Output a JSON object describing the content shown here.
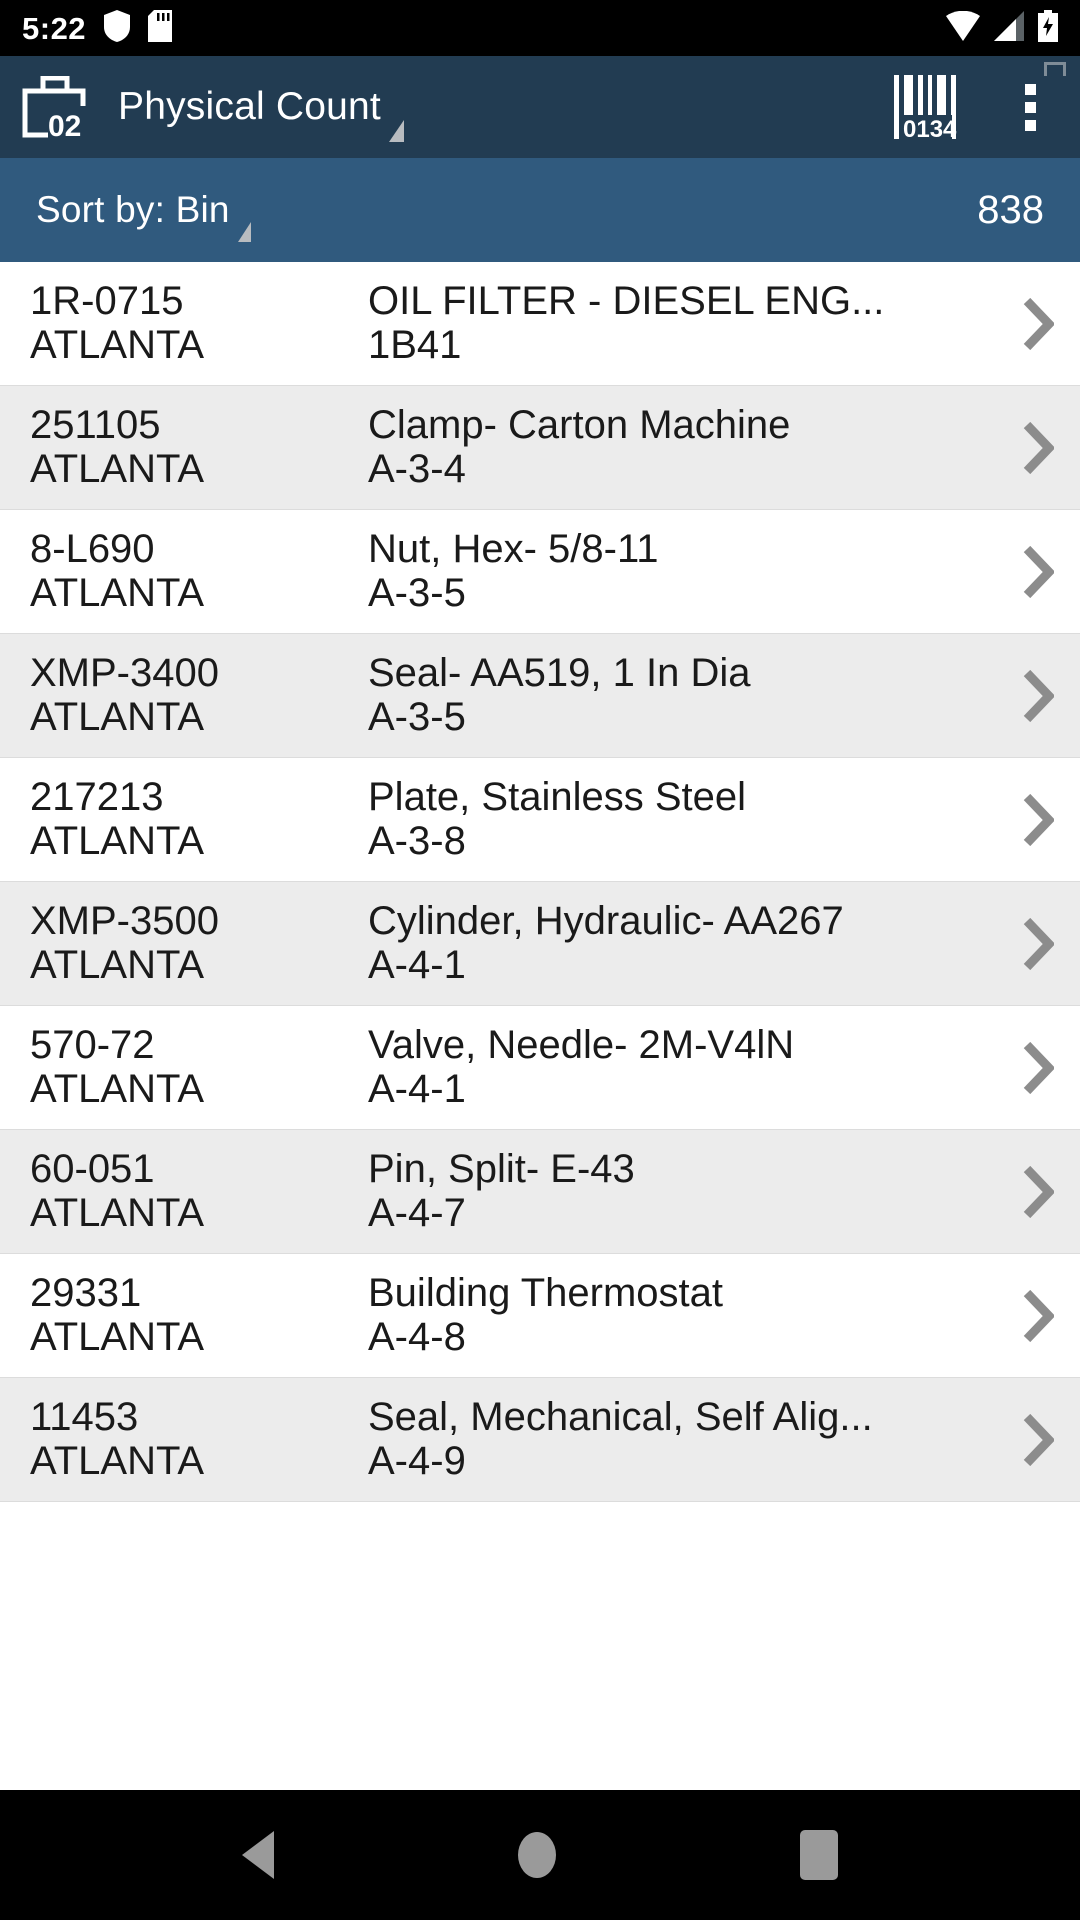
{
  "status_bar": {
    "time": "5:22",
    "left_icons": [
      "shield-icon",
      "sd-card-icon"
    ],
    "right_icons": [
      "wifi-icon",
      "cellular-signal-icon",
      "battery-charging-icon"
    ]
  },
  "app_bar": {
    "logo": "toolbox-count-icon",
    "title": "Physical Count",
    "title_dropdown": "dropdown-caret",
    "barcode_label": "0134",
    "overflow": "overflow-menu-icon"
  },
  "sort_bar": {
    "label": "Sort by: Bin",
    "count": "838"
  },
  "list": {
    "rows": [
      {
        "item": "1R-0715",
        "location": "ATLANTA",
        "description": "OIL FILTER - DIESEL ENG...",
        "bin": "1B41"
      },
      {
        "item": "251105",
        "location": "ATLANTA",
        "description": "Clamp- Carton Machine",
        "bin": "A-3-4"
      },
      {
        "item": "8-L690",
        "location": "ATLANTA",
        "description": "Nut, Hex- 5/8-11",
        "bin": "A-3-5"
      },
      {
        "item": "XMP-3400",
        "location": "ATLANTA",
        "description": "Seal- AA519, 1 In Dia",
        "bin": "A-3-5"
      },
      {
        "item": "217213",
        "location": "ATLANTA",
        "description": "Plate, Stainless Steel",
        "bin": "A-3-8"
      },
      {
        "item": "XMP-3500",
        "location": "ATLANTA",
        "description": "Cylinder, Hydraulic- AA267",
        "bin": "A-4-1"
      },
      {
        "item": "570-72",
        "location": "ATLANTA",
        "description": "Valve, Needle- 2M-V4lN",
        "bin": "A-4-1"
      },
      {
        "item": "60-051",
        "location": "ATLANTA",
        "description": "Pin, Split- E-43",
        "bin": "A-4-7"
      },
      {
        "item": "29331",
        "location": "ATLANTA",
        "description": "Building Thermostat",
        "bin": "A-4-8"
      },
      {
        "item": "11453",
        "location": "ATLANTA",
        "description": "Seal, Mechanical, Self Alig...",
        "bin": "A-4-9"
      }
    ]
  },
  "nav_bar": {
    "back": "back-nav-icon",
    "home": "home-nav-icon",
    "recents": "recents-nav-icon"
  },
  "colors": {
    "status_bar_bg": "#000000",
    "app_bar_bg": "#223c52",
    "sort_bar_bg": "#305a7e",
    "row_even_bg": "#ffffff",
    "row_odd_bg": "#ececec",
    "text_primary": "#1a1a1a",
    "chevron": "#8c8c8c"
  }
}
